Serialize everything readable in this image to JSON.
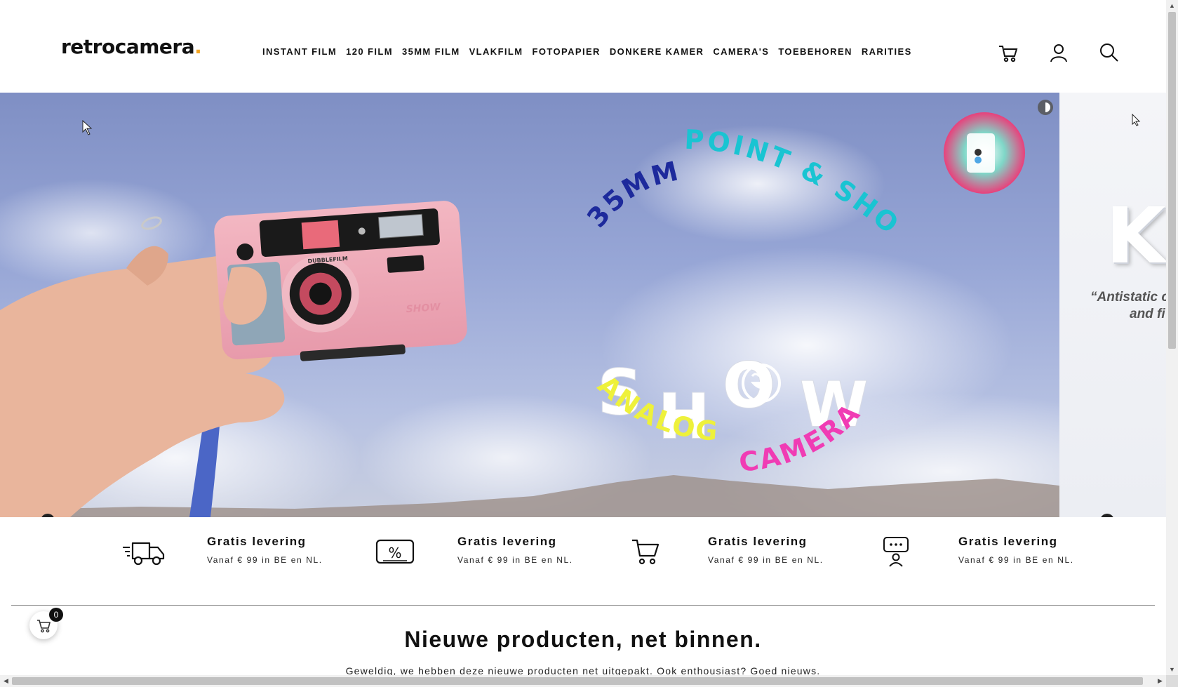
{
  "header": {
    "logo": {
      "text": "retrocamera",
      "dot": "."
    },
    "nav": [
      {
        "label": "INSTANT FILM"
      },
      {
        "label": "120 FILM"
      },
      {
        "label": "35MM FILM"
      },
      {
        "label": "VLAKFILM"
      },
      {
        "label": "FOTOPAPIER"
      },
      {
        "label": "DONKERE KAMER"
      },
      {
        "label": "CAMERA'S"
      },
      {
        "label": "TOEBEHOREN"
      },
      {
        "label": "RARITIES"
      }
    ],
    "icons": [
      "cart-icon",
      "user-icon",
      "search-icon"
    ]
  },
  "hero": {
    "slide": {
      "line_top_left": "35MM",
      "line_top_right": "POINT & SHOOT",
      "big_word": [
        "S",
        "H",
        "O",
        "W"
      ],
      "line_bottom_left": "ANALOG",
      "line_bottom_right": "CAMERA",
      "camera_brand": "DUBBLEFILM",
      "camera_model": "SHOW",
      "colors": {
        "cyan": "#19c4d2",
        "navy": "#1d2a9c",
        "yellow": "#eef13b",
        "magenta": "#f03cb4"
      }
    },
    "next_slide": {
      "title_fragment": "Ki",
      "quote_line1": "“Antistatic c",
      "quote_line2": "and fi"
    }
  },
  "features": [
    {
      "icon": "truck-icon",
      "title": "Gratis levering",
      "subtitle": "Vanaf € 99 in BE en NL."
    },
    {
      "icon": "discount-ticket-icon",
      "title": "Gratis levering",
      "subtitle": "Vanaf € 99 in BE en NL."
    },
    {
      "icon": "cart-icon",
      "title": "Gratis levering",
      "subtitle": "Vanaf € 99 in BE en NL."
    },
    {
      "icon": "support-chat-icon",
      "title": "Gratis levering",
      "subtitle": "Vanaf € 99 in BE en NL."
    }
  ],
  "section": {
    "title": "Nieuwe producten, net binnen.",
    "subtitle": "Geweldig, we hebben deze nieuwe producten net uitgepakt. Ook enthousiast? Goed nieuws."
  },
  "floating_cart": {
    "count": "0"
  }
}
